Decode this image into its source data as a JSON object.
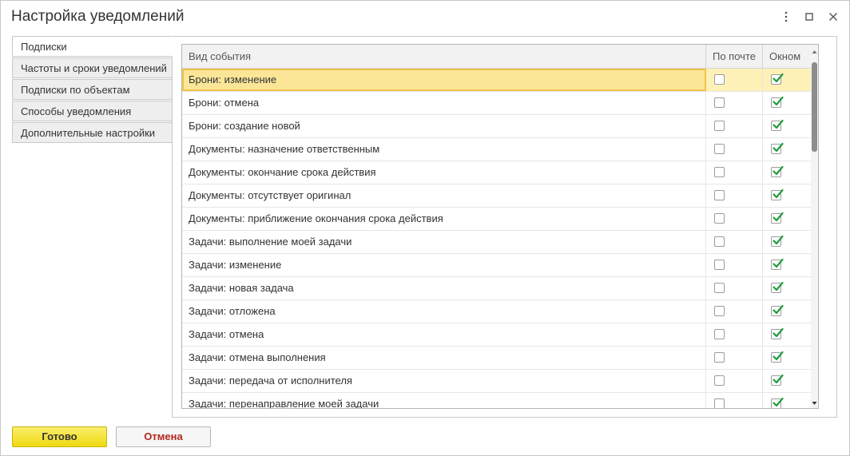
{
  "window": {
    "title": "Настройка уведомлений"
  },
  "tabs": [
    {
      "label": "Подписки",
      "active": true
    },
    {
      "label": "Частоты и сроки уведомлений",
      "active": false
    },
    {
      "label": "Подписки по объектам",
      "active": false
    },
    {
      "label": "Способы уведомления",
      "active": false
    },
    {
      "label": "Дополнительные настройки",
      "active": false
    }
  ],
  "table": {
    "columns": {
      "event": "Вид события",
      "email": "По почте",
      "window": "Окном"
    },
    "rows": [
      {
        "event": "Брони: изменение",
        "email": false,
        "window": true
      },
      {
        "event": "Брони: отмена",
        "email": false,
        "window": true
      },
      {
        "event": "Брони: создание новой",
        "email": false,
        "window": true
      },
      {
        "event": "Документы: назначение ответственным",
        "email": false,
        "window": true
      },
      {
        "event": "Документы: окончание срока действия",
        "email": false,
        "window": true
      },
      {
        "event": "Документы: отсутствует оригинал",
        "email": false,
        "window": true
      },
      {
        "event": "Документы: приближение окончания срока действия",
        "email": false,
        "window": true
      },
      {
        "event": "Задачи: выполнение моей задачи",
        "email": false,
        "window": true
      },
      {
        "event": "Задачи: изменение",
        "email": false,
        "window": true
      },
      {
        "event": "Задачи: новая задача",
        "email": false,
        "window": true
      },
      {
        "event": "Задачи: отложена",
        "email": false,
        "window": true
      },
      {
        "event": "Задачи: отмена",
        "email": false,
        "window": true
      },
      {
        "event": "Задачи: отмена выполнения",
        "email": false,
        "window": true
      },
      {
        "event": "Задачи: передача от исполнителя",
        "email": false,
        "window": true
      },
      {
        "event": "Задачи: перенаправление моей задачи",
        "email": false,
        "window": true
      }
    ]
  },
  "buttons": {
    "ok": "Готово",
    "cancel": "Отмена"
  },
  "icons": {
    "more": "more-vertical-icon",
    "maximize": "maximize-icon",
    "close": "close-icon",
    "check": "checkmark-icon"
  },
  "colors": {
    "accent_yellow": "#f7e43b",
    "selection": "#fbe697",
    "check_green": "#1e9c3c",
    "cancel_text": "#b3261e"
  }
}
